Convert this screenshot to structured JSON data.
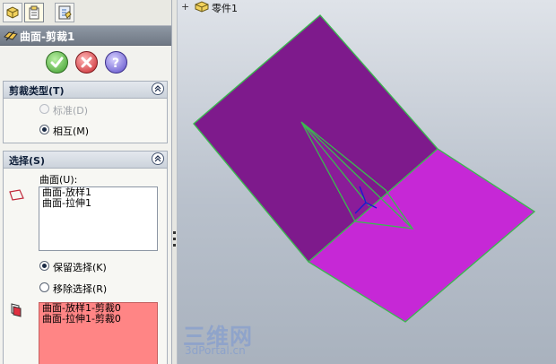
{
  "feature_manager": {
    "title": "曲面-剪裁1",
    "tabs": [
      "feature-tree-tab",
      "property-manager-tab",
      "configuration-tab"
    ]
  },
  "actions": {
    "ok": "ok-icon",
    "cancel": "cancel-icon",
    "help": "help-icon"
  },
  "trim_type": {
    "title": "剪裁类型(T)",
    "options": [
      {
        "label": "标准(D)",
        "selected": false,
        "enabled": false
      },
      {
        "label": "相互(M)",
        "selected": true,
        "enabled": true
      }
    ]
  },
  "selection": {
    "title": "选择(S)",
    "surfaces_label": "曲面(U):",
    "surfaces": [
      "曲面-放样1",
      "曲面-拉伸1"
    ],
    "keep_option": "保留选择(K)",
    "remove_option": "移除选择(R)",
    "keep_selected": true,
    "pieces": [
      "曲面-放样1-剪裁0",
      "曲面-拉伸1-剪裁0"
    ]
  },
  "graphics": {
    "tree_label": "零件1",
    "tree_expand": "+",
    "colors": {
      "surface_dark": "#7e1a8c",
      "surface_light": "#c628d6",
      "edge": "#3cb850"
    }
  },
  "watermark": {
    "text": "三维网",
    "url": "3dPortal.cn"
  }
}
